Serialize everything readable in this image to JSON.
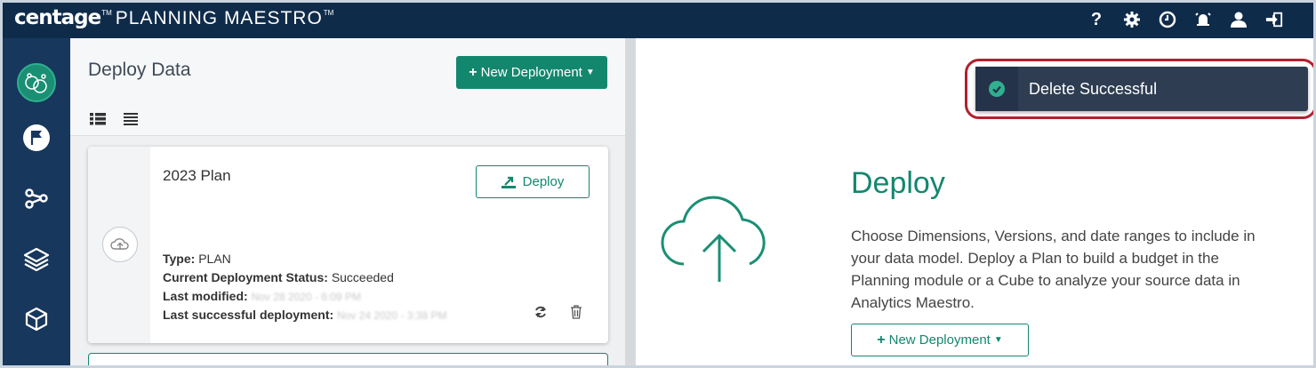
{
  "brand": {
    "name": "centage",
    "tm": "TM",
    "product": "PLANNING MAESTRO",
    "product_tm": "TM"
  },
  "top_icons": [
    "help-icon",
    "gear-icon",
    "clock-icon",
    "alarm-icon",
    "user-icon",
    "sign-out-icon"
  ],
  "help_glyph": "?",
  "rail": [
    "app-logo",
    "flag-icon",
    "share-nodes-icon",
    "layers-icon",
    "cube-icon"
  ],
  "mid": {
    "title": "Deploy Data",
    "new_button": "New Deployment",
    "views": [
      "list-view-icon",
      "compact-view-icon"
    ]
  },
  "card": {
    "title": "2023 Plan",
    "deploy_button": "Deploy",
    "type_label": "Type:",
    "type_value": "PLAN",
    "status_label": "Current Deployment Status:",
    "status_value": "Succeeded",
    "modified_label": "Last modified:",
    "modified_value": "Nov 28 2020 - 6:09 PM",
    "success_label": "Last successful deployment:",
    "success_value": "Nov 24 2020 - 3:38 PM",
    "actions": [
      "refresh-icon",
      "trash-icon"
    ]
  },
  "toast": {
    "message": "Delete Successful"
  },
  "right": {
    "title": "Deploy",
    "description": "Choose Dimensions, Versions, and date ranges to include in your data model. Deploy a Plan to build a budget in the Planning module or a Cube to analyze your source data in Analytics Maestro.",
    "new_button": "New Deployment"
  },
  "colors": {
    "topbar": "#0f2b4a",
    "rail": "#17375c",
    "accent": "#13876e",
    "toast": "#2e3d52",
    "highlight": "#b3202f"
  }
}
